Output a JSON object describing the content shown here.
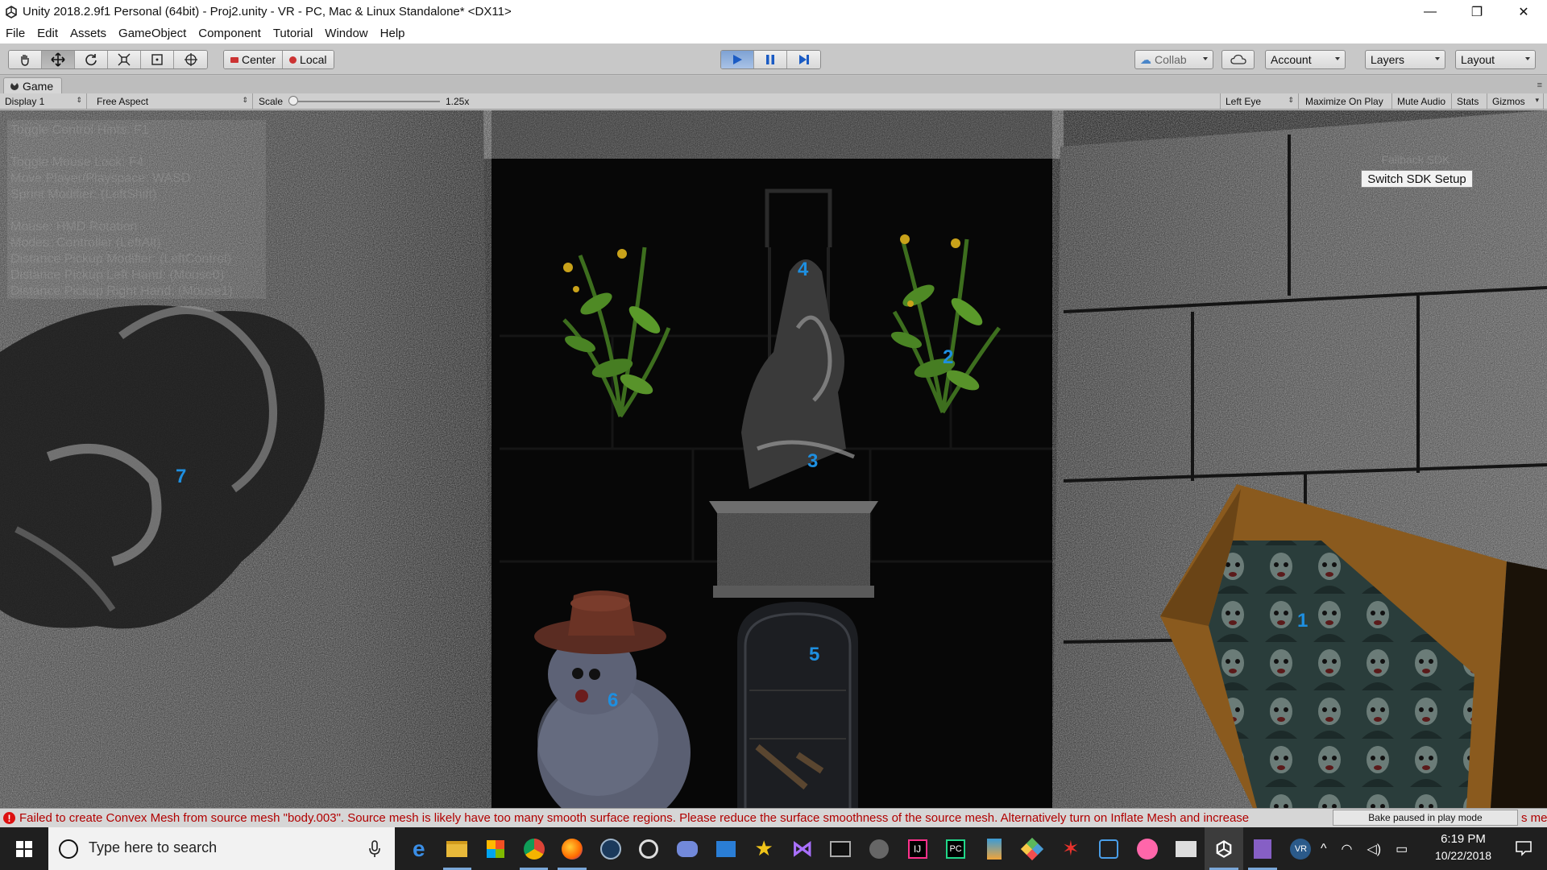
{
  "window": {
    "title": "Unity 2018.2.9f1 Personal (64bit) - Proj2.unity - VR - PC, Mac & Linux Standalone* <DX11>",
    "controls": {
      "minimize": "—",
      "maximize": "❐",
      "close": "✕"
    }
  },
  "menu": [
    "File",
    "Edit",
    "Assets",
    "GameObject",
    "Component",
    "Tutorial",
    "Window",
    "Help"
  ],
  "toolbar": {
    "tools": [
      "hand-icon",
      "move-icon",
      "rotate-icon",
      "scale-icon",
      "rect-icon",
      "transform-icon"
    ],
    "active_tool": "move",
    "pivot_center": "Center",
    "pivot_local": "Local",
    "play_state": "playing",
    "collab": "Collab",
    "account": "Account",
    "layers": "Layers",
    "layout": "Layout"
  },
  "game_tab": {
    "label": "Game",
    "display": "Display 1",
    "aspect": "Free Aspect",
    "scale_label": "Scale",
    "scale_value": "1.25x",
    "scale_fraction": 0.0,
    "eye": "Left Eye",
    "maximize": "Maximize On Play",
    "mute": "Mute Audio",
    "stats": "Stats",
    "gizmos": "Gizmos"
  },
  "viewport": {
    "help_lines": [
      "Toggle Control Hints: F1",
      "Toggle Mouse Lock: F4",
      "Move Player/Playspace: WASD",
      "Sprint Modifier: (LeftShift)",
      "Mouse: HMD Rotation",
      "Modes: Controller (LeftAlt)",
      "Distance Pickup Modifier: (LeftControl)",
      "Distance Pickup Left Hand: (Mouse0)",
      "Distance Pickup Right Hand: (Mouse1)"
    ],
    "sdk_faint": "Fallback SDK",
    "sdk_button": "Switch SDK Setup",
    "markers": [
      "1",
      "2",
      "3",
      "4",
      "5",
      "6",
      "7"
    ]
  },
  "console": {
    "message": "Failed to create Convex Mesh from source mesh \"body.003\". Source mesh is likely have too many smooth surface regions. Please reduce the surface smoothness of the source mesh. Alternatively turn on Inflate Mesh and increase",
    "bake_status": "Bake paused in play mode",
    "tail": "s me"
  },
  "taskbar": {
    "search_placeholder": "Type here to search",
    "apps": [
      "edge-icon",
      "file-explorer-icon",
      "store-icon",
      "chrome-icon",
      "firefox-icon",
      "steam-icon",
      "obs-icon",
      "discord-icon",
      "outlook-icon",
      "star-app-icon",
      "visual-studio-icon",
      "terminal-icon",
      "app-face-icon",
      "intellij-icon",
      "pycharm-icon",
      "blender-icon",
      "git-icon",
      "red-app-icon",
      "teamviewer-icon",
      "osu-icon",
      "photos-icon",
      "unity-icon",
      "vs-purple-icon",
      "vr-icon"
    ],
    "time": "6:19 PM",
    "date": "10/22/2018"
  },
  "colors": {
    "marker": "#1e8fe0",
    "console_error": "#b10000",
    "play_active": "#4a7fc9"
  }
}
